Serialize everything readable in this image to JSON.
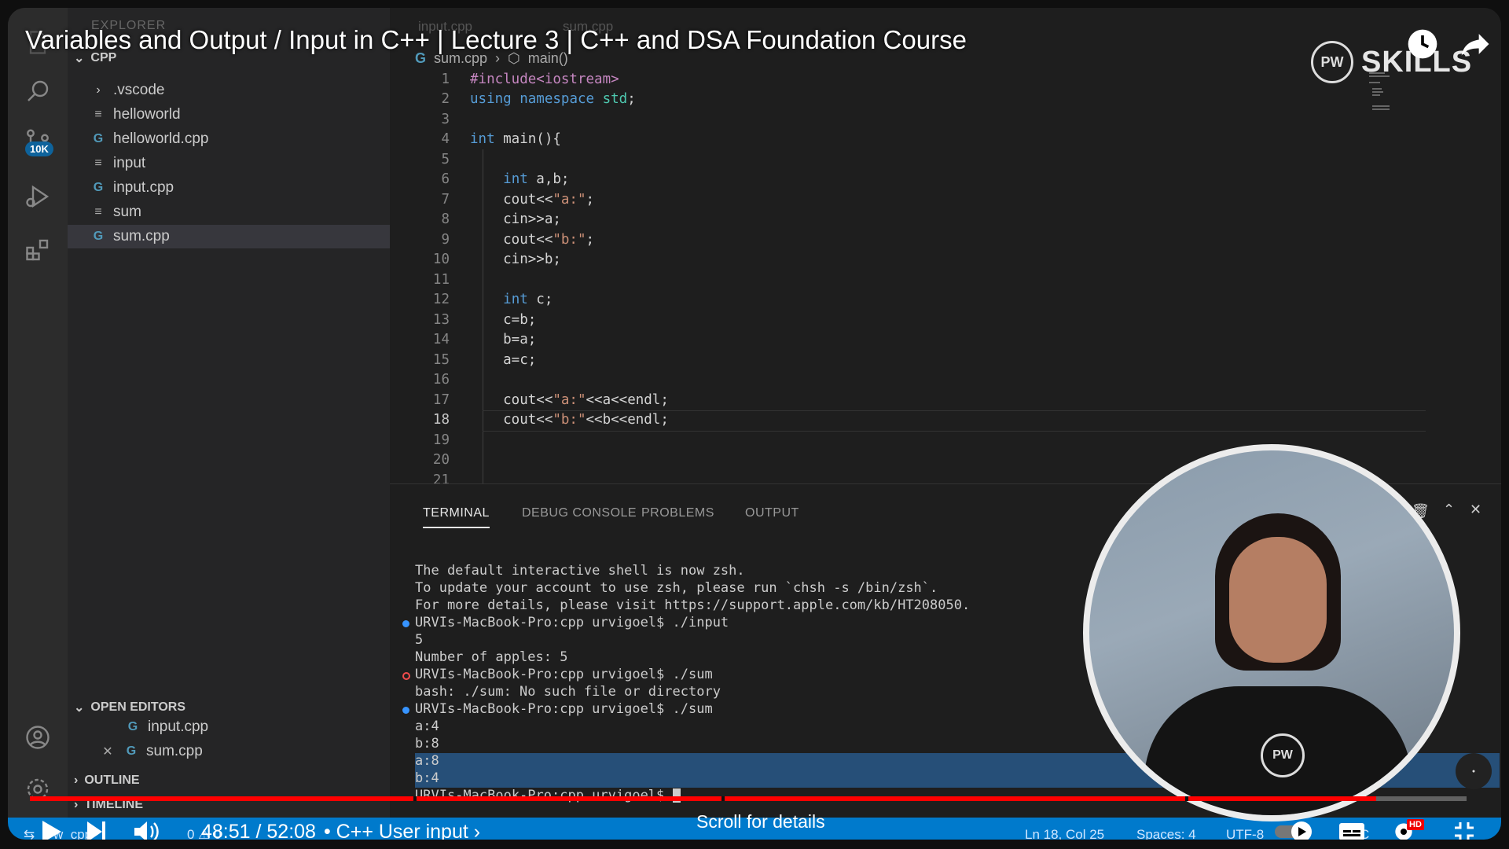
{
  "video": {
    "title": "Variables and Output / Input in C++ | Lecture 3 | C++ and DSA Foundation Course",
    "time_current": "48:51",
    "time_total": "52:08",
    "time_display": "48:51 / 52:08",
    "chapter": "• C++ User input ›",
    "scroll_hint": "Scroll for details",
    "progress_percent": 93.7,
    "watermark": "SKILLS",
    "hd_badge": "HD"
  },
  "activity_bar": {
    "source_control_badge": "10K"
  },
  "sidebar": {
    "explorer_label": "EXPLORER",
    "folder": "CPP",
    "files": [
      {
        "name": ".vscode",
        "type": "folder"
      },
      {
        "name": "helloworld",
        "type": "file"
      },
      {
        "name": "helloworld.cpp",
        "type": "cpp"
      },
      {
        "name": "input",
        "type": "file"
      },
      {
        "name": "input.cpp",
        "type": "cpp"
      },
      {
        "name": "sum",
        "type": "file"
      },
      {
        "name": "sum.cpp",
        "type": "cpp"
      }
    ],
    "open_editors_label": "OPEN EDITORS",
    "open_editors": [
      "input.cpp",
      "sum.cpp"
    ],
    "outline_label": "OUTLINE",
    "timeline_label": "TIMELINE"
  },
  "editor": {
    "tabs": [
      "input.cpp",
      "sum.cpp"
    ],
    "breadcrumb_file": "sum.cpp",
    "breadcrumb_symbol": "main()",
    "current_line": 18,
    "lines": [
      "#include<iostream>",
      "using namespace std;",
      "",
      "int main(){",
      "",
      "    int a,b;",
      "    cout<<\"a:\";",
      "    cin>>a;",
      "    cout<<\"b:\";",
      "    cin>>b;",
      "",
      "    int c;",
      "    c=b;",
      "    b=a;",
      "    a=c;",
      "",
      "    cout<<\"a:\"<<a<<endl;",
      "    cout<<\"b:\"<<b<<endl;",
      "",
      "",
      ""
    ]
  },
  "panel": {
    "tabs": [
      "TERMINAL",
      "DEBUG CONSOLE",
      "PROBLEMS",
      "OUTPUT"
    ],
    "terminal_lines": [
      "The default interactive shell is now zsh.",
      "To update your account to use zsh, please run `chsh -s /bin/zsh`.",
      "For more details, please visit https://support.apple.com/kb/HT208050.",
      "URVIs-MacBook-Pro:cpp urvigoel$ ./input",
      "5",
      "Number of apples: 5",
      "URVIs-MacBook-Pro:cpp urvigoel$ ./sum",
      "bash: ./sum: No such file or directory",
      "URVIs-MacBook-Pro:cpp urvigoel$ ./sum",
      "a:4",
      "b:8",
      "a:8",
      "b:4",
      "URVIs-MacBook-Pro:cpp urvigoel$ "
    ]
  },
  "status_bar": {
    "branch": "w_cpp*",
    "problems": "0 ⚠ 0",
    "position": "Ln 18, Col 25",
    "spaces": "Spaces: 4",
    "encoding": "UTF-8",
    "lang": "C"
  },
  "colors": {
    "accent": "#007acc",
    "progress": "#ff0000",
    "keyword": "#569cd6",
    "string": "#ce9178"
  }
}
